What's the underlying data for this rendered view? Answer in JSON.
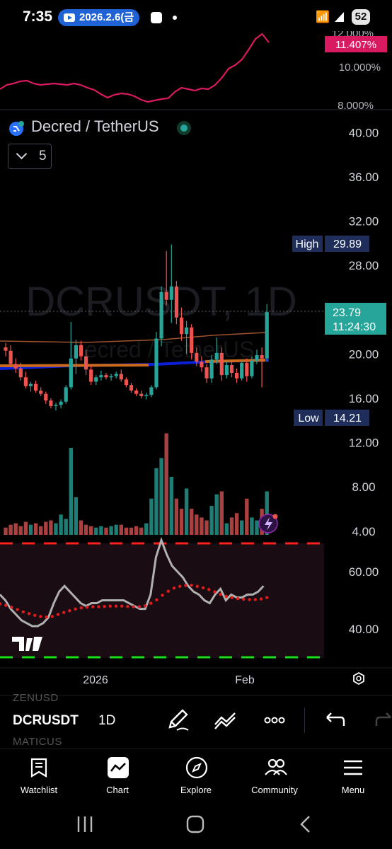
{
  "status_bar": {
    "time": "7:35",
    "notification": "2026.2.6(금",
    "battery": "52"
  },
  "top_pane": {
    "current_value": "11.407%",
    "axis_ticks": [
      "12.000%",
      "10.000%",
      "8.000%"
    ]
  },
  "symbol": {
    "title": "Decred / TetherUS",
    "collapse_count": "5",
    "watermark_ticker": "DCRUSDT, 1D",
    "watermark_name": "Decred / TetherUS"
  },
  "price_axis": {
    "ticks": [
      "40.00",
      "36.00",
      "32.00",
      "28.00",
      "20.00",
      "16.00",
      "12.00",
      "8.00",
      "4.00"
    ]
  },
  "price_labels": {
    "high_label": "High",
    "high_value": "29.89",
    "low_label": "Low",
    "low_value": "14.21",
    "last_price": "23.79",
    "countdown": "11:24:30"
  },
  "rsi_pane": {
    "axis_ticks": [
      "60.00",
      "40.00"
    ]
  },
  "time_axis": {
    "labels": [
      "2026",
      "Feb"
    ]
  },
  "symbol_bar": {
    "prev_ticker": "ZENUSD",
    "ticker": "DCRUSDT",
    "interval": "1D",
    "next_ticker": "MATICUS"
  },
  "bottom_nav": [
    {
      "label": "Watchlist",
      "icon": "watchlist-icon"
    },
    {
      "label": "Chart",
      "icon": "chart-icon"
    },
    {
      "label": "Explore",
      "icon": "compass-icon"
    },
    {
      "label": "Community",
      "icon": "community-icon"
    },
    {
      "label": "Menu",
      "icon": "menu-icon"
    }
  ],
  "colors": {
    "up": "#26a69a",
    "down": "#ef5350",
    "accent_pink": "#d81b60",
    "label_blue": "#1e2d5a",
    "rsi_bg": "#190c12"
  },
  "chart_data": {
    "type": "candlestick",
    "symbol": "DCRUSDT",
    "interval": "1D",
    "candles": [
      {
        "o": 20.6,
        "h": 21.0,
        "l": 19.8,
        "c": 20.3
      },
      {
        "o": 20.3,
        "h": 20.8,
        "l": 18.8,
        "c": 19.1
      },
      {
        "o": 19.1,
        "h": 19.6,
        "l": 18.3,
        "c": 18.7
      },
      {
        "o": 18.7,
        "h": 19.2,
        "l": 17.6,
        "c": 17.9
      },
      {
        "o": 17.9,
        "h": 18.4,
        "l": 16.9,
        "c": 17.1
      },
      {
        "o": 17.1,
        "h": 17.5,
        "l": 16.6,
        "c": 17.3
      },
      {
        "o": 17.3,
        "h": 17.6,
        "l": 16.5,
        "c": 16.7
      },
      {
        "o": 16.7,
        "h": 17.0,
        "l": 16.2,
        "c": 16.4
      },
      {
        "o": 16.4,
        "h": 16.6,
        "l": 15.5,
        "c": 15.8
      },
      {
        "o": 15.8,
        "h": 16.0,
        "l": 15.1,
        "c": 15.3
      },
      {
        "o": 15.3,
        "h": 15.6,
        "l": 14.9,
        "c": 15.4
      },
      {
        "o": 15.4,
        "h": 15.9,
        "l": 15.1,
        "c": 15.7
      },
      {
        "o": 15.7,
        "h": 17.2,
        "l": 15.5,
        "c": 17.0
      },
      {
        "o": 17.0,
        "h": 22.9,
        "l": 16.8,
        "c": 19.6
      },
      {
        "o": 19.6,
        "h": 21.3,
        "l": 18.2,
        "c": 20.8
      },
      {
        "o": 20.8,
        "h": 21.2,
        "l": 19.4,
        "c": 19.8
      },
      {
        "o": 19.8,
        "h": 20.4,
        "l": 18.1,
        "c": 18.6
      },
      {
        "o": 18.6,
        "h": 19.0,
        "l": 17.2,
        "c": 17.5
      },
      {
        "o": 17.5,
        "h": 18.1,
        "l": 17.2,
        "c": 17.9
      },
      {
        "o": 17.9,
        "h": 18.5,
        "l": 17.6,
        "c": 18.1
      },
      {
        "o": 18.1,
        "h": 18.3,
        "l": 17.7,
        "c": 17.9
      },
      {
        "o": 17.9,
        "h": 18.2,
        "l": 17.6,
        "c": 18.0
      },
      {
        "o": 18.0,
        "h": 18.4,
        "l": 17.8,
        "c": 18.2
      },
      {
        "o": 18.2,
        "h": 18.6,
        "l": 17.5,
        "c": 17.7
      },
      {
        "o": 17.7,
        "h": 17.9,
        "l": 17.0,
        "c": 17.2
      },
      {
        "o": 17.2,
        "h": 17.4,
        "l": 16.5,
        "c": 16.7
      },
      {
        "o": 16.7,
        "h": 16.9,
        "l": 16.2,
        "c": 16.4
      },
      {
        "o": 16.4,
        "h": 16.7,
        "l": 16.0,
        "c": 16.2
      },
      {
        "o": 16.2,
        "h": 16.5,
        "l": 15.9,
        "c": 16.3
      },
      {
        "o": 16.3,
        "h": 17.2,
        "l": 16.1,
        "c": 17.0
      },
      {
        "o": 17.0,
        "h": 22.0,
        "l": 16.8,
        "c": 21.4
      },
      {
        "o": 21.4,
        "h": 26.1,
        "l": 20.7,
        "c": 25.6
      },
      {
        "o": 25.6,
        "h": 29.3,
        "l": 24.4,
        "c": 24.9
      },
      {
        "o": 24.9,
        "h": 29.89,
        "l": 22.8,
        "c": 26.1
      },
      {
        "o": 26.1,
        "h": 26.6,
        "l": 22.7,
        "c": 23.3
      },
      {
        "o": 23.3,
        "h": 24.2,
        "l": 21.2,
        "c": 21.8
      },
      {
        "o": 21.8,
        "h": 23.0,
        "l": 20.0,
        "c": 22.4
      },
      {
        "o": 22.4,
        "h": 22.7,
        "l": 19.5,
        "c": 20.1
      },
      {
        "o": 20.1,
        "h": 20.6,
        "l": 18.9,
        "c": 19.3
      },
      {
        "o": 19.3,
        "h": 19.8,
        "l": 18.4,
        "c": 18.8
      },
      {
        "o": 18.8,
        "h": 19.1,
        "l": 17.4,
        "c": 17.8
      },
      {
        "o": 17.8,
        "h": 19.9,
        "l": 17.4,
        "c": 19.5
      },
      {
        "o": 19.5,
        "h": 21.5,
        "l": 19.1,
        "c": 20.1
      },
      {
        "o": 20.1,
        "h": 20.6,
        "l": 17.6,
        "c": 18.1
      },
      {
        "o": 18.1,
        "h": 19.3,
        "l": 17.8,
        "c": 19.0
      },
      {
        "o": 19.0,
        "h": 19.4,
        "l": 17.9,
        "c": 18.3
      },
      {
        "o": 18.3,
        "h": 18.7,
        "l": 17.4,
        "c": 17.8
      },
      {
        "o": 17.8,
        "h": 19.5,
        "l": 17.6,
        "c": 19.2
      },
      {
        "o": 19.2,
        "h": 19.6,
        "l": 17.5,
        "c": 18.0
      },
      {
        "o": 18.0,
        "h": 19.8,
        "l": 17.8,
        "c": 19.4
      },
      {
        "o": 19.4,
        "h": 20.4,
        "l": 19.1,
        "c": 19.9
      },
      {
        "o": 19.9,
        "h": 20.6,
        "l": 17.0,
        "c": 19.6
      },
      {
        "o": 19.6,
        "h": 24.5,
        "l": 19.3,
        "c": 23.79
      }
    ],
    "volume": [
      5,
      7,
      8,
      6,
      9,
      7,
      8,
      6,
      9,
      10,
      8,
      14,
      11,
      60,
      26,
      10,
      7,
      6,
      5,
      6,
      5,
      6,
      7,
      7,
      5,
      5,
      6,
      5,
      8,
      25,
      46,
      53,
      70,
      40,
      25,
      18,
      32,
      18,
      14,
      12,
      10,
      20,
      28,
      30,
      8,
      12,
      15,
      10,
      25,
      12,
      10,
      18,
      30
    ],
    "rsi": [
      52,
      50,
      47,
      45,
      43,
      42,
      41,
      41,
      42,
      44,
      49,
      53,
      55,
      53,
      51,
      49,
      48,
      49,
      49,
      50,
      50,
      50,
      50,
      50,
      49,
      48,
      47,
      47,
      52,
      65,
      71,
      66,
      62,
      60,
      58,
      55,
      53,
      52,
      50,
      49,
      52,
      54,
      50,
      52,
      51,
      51,
      52,
      52,
      53,
      55
    ],
    "rsi_ma": [
      50,
      49.5,
      48.8,
      48,
      47.2,
      46.6,
      46,
      45.6,
      45.4,
      45.6,
      46.3,
      47,
      47.6,
      48.2,
      48.6,
      48.8,
      49,
      49,
      49.1,
      49.2,
      49.2,
      49.2,
      49.1,
      49,
      49,
      49.3,
      50.2,
      51.4,
      53,
      54.4,
      55.5,
      56.1,
      56.4,
      56.5,
      56.1,
      55.6,
      55,
      54.2,
      53.3,
      52.6,
      52.2,
      51.8,
      51.6,
      51.5,
      51.5,
      51.7,
      52.2
    ]
  }
}
